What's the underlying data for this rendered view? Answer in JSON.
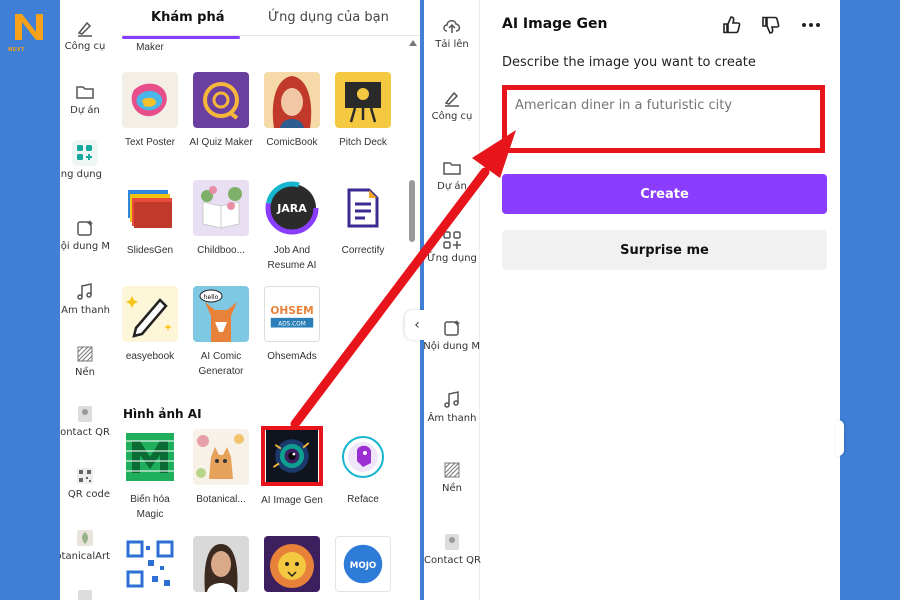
{
  "brand": {
    "name": "NEXT",
    "accent": "#f6a21a"
  },
  "left_rail": [
    {
      "label": "Công cụ",
      "icon": "brush-icon"
    },
    {
      "label": "Dự án",
      "icon": "folder-icon"
    },
    {
      "label": "Ứng dụng",
      "icon": "apps-icon",
      "active": true
    },
    {
      "label": "Nội dung M...",
      "icon": "magic-media-icon"
    },
    {
      "label": "Âm thanh",
      "icon": "music-icon"
    },
    {
      "label": "Nền",
      "icon": "background-icon"
    },
    {
      "label": "Contact QR",
      "icon": "contact-qr-icon"
    },
    {
      "label": "QR code",
      "icon": "qr-code-icon"
    },
    {
      "label": "BotanicalArt",
      "icon": "botanical-icon"
    }
  ],
  "tabs": {
    "discover": "Khám phá",
    "your_apps": "Ứng dụng của bạn"
  },
  "partial_row": {
    "label": "Maker"
  },
  "apps_rows": [
    [
      {
        "name": "Text Poster",
        "thumb": "text-poster-thumb"
      },
      {
        "name": "AI Quiz Maker",
        "thumb": "ai-quiz-thumb"
      },
      {
        "name": "ComicBook",
        "thumb": "comicbook-thumb"
      },
      {
        "name": "Pitch Deck",
        "thumb": "pitch-deck-thumb"
      }
    ],
    [
      {
        "name": "SlidesGen",
        "thumb": "slidesgen-thumb"
      },
      {
        "name": "Childboo...",
        "thumb": "childbook-thumb"
      },
      {
        "name": "Job And Resume AI",
        "thumb": "jara-thumb",
        "text": "JARA"
      },
      {
        "name": "Correctify",
        "thumb": "correctify-thumb"
      }
    ],
    [
      {
        "name": "easyebook",
        "thumb": "easyebook-thumb"
      },
      {
        "name": "AI Comic Generator",
        "thumb": "ai-comic-thumb",
        "text": "hello"
      },
      {
        "name": "OhsemAds",
        "thumb": "ohsemads-thumb",
        "text": "OHSEM",
        "text2": "ADS.COM"
      }
    ]
  ],
  "ai_section": {
    "title": "Hình ảnh AI",
    "apps": [
      {
        "name": "Biến hóa Magic",
        "thumb": "magic-morph-thumb"
      },
      {
        "name": "Botanical...",
        "thumb": "botanical-thumb"
      },
      {
        "name": "AI Image Gen",
        "thumb": "ai-image-gen-thumb",
        "highlighted": true
      },
      {
        "name": "Reface",
        "thumb": "reface-thumb"
      }
    ],
    "more": [
      {
        "thumb": "qr-thumb"
      },
      {
        "thumb": "portrait-thumb"
      },
      {
        "thumb": "lion-thumb"
      },
      {
        "thumb": "mojo-thumb",
        "text": "MOJO"
      }
    ]
  },
  "right_rail": [
    {
      "label": "Tải lên",
      "icon": "upload-icon"
    },
    {
      "label": "Công cụ",
      "icon": "brush-icon"
    },
    {
      "label": "Dự án",
      "icon": "folder-icon"
    },
    {
      "label": "Ứng dụng",
      "icon": "apps-icon"
    },
    {
      "label": "Nội dung M...",
      "icon": "magic-media-icon"
    },
    {
      "label": "Âm thanh",
      "icon": "music-icon"
    },
    {
      "label": "Nền",
      "icon": "background-icon"
    },
    {
      "label": "Contact QR",
      "icon": "contact-qr-icon"
    }
  ],
  "generator": {
    "title": "AI Image Gen",
    "subtitle": "Describe the image you want to create",
    "prompt_value": "",
    "prompt_placeholder": "American diner in a futuristic city",
    "create_label": "Create",
    "surprise_label": "Surprise me",
    "header_icons": [
      "thumbs-up-icon",
      "thumbs-down-icon",
      "more-icon"
    ]
  },
  "colors": {
    "primary": "#8b3dff",
    "highlight": "#e8141c",
    "background": "#3f7fd6"
  }
}
